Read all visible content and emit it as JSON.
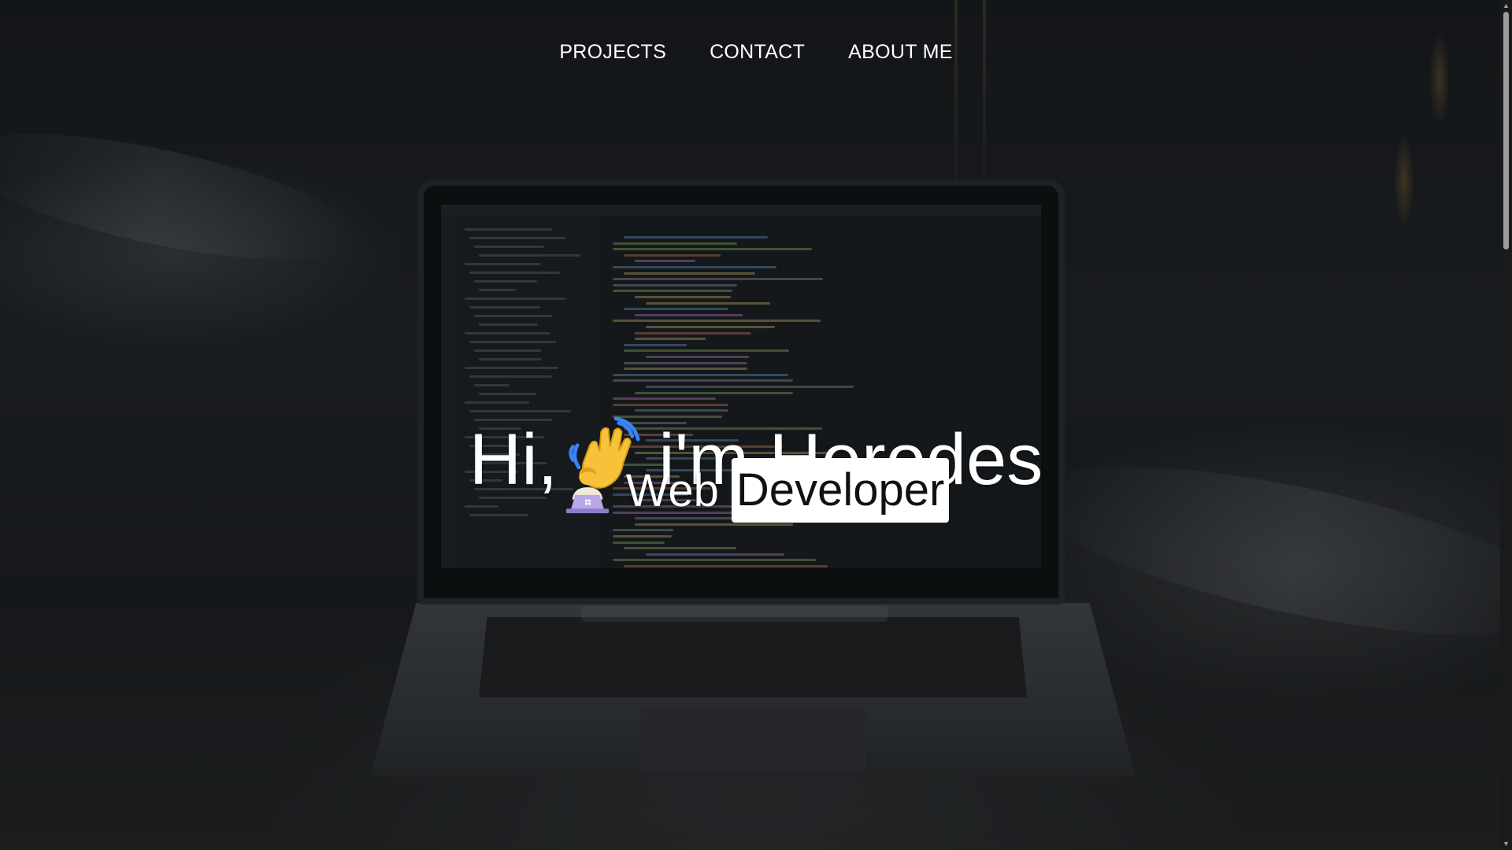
{
  "nav": {
    "items": [
      {
        "label": "PROJECTS"
      },
      {
        "label": "CONTACT"
      },
      {
        "label": "ABOUT ME"
      }
    ]
  },
  "hero": {
    "greeting_prefix": "Hi,",
    "greeting_icon": "waving-hand-icon",
    "greeting_suffix": "i'm Herodes",
    "subtitle_icon": "technologist-icon",
    "subtitle_word": "Web",
    "subtitle_highlight": "Developer"
  },
  "colors": {
    "text": "#ffffff",
    "highlight_bg": "#ffffff",
    "highlight_text": "#111111",
    "background": "#1b1d1f"
  },
  "scrollbar": {
    "up_icon": "arrow-up-icon",
    "down_icon": "arrow-down-icon"
  }
}
